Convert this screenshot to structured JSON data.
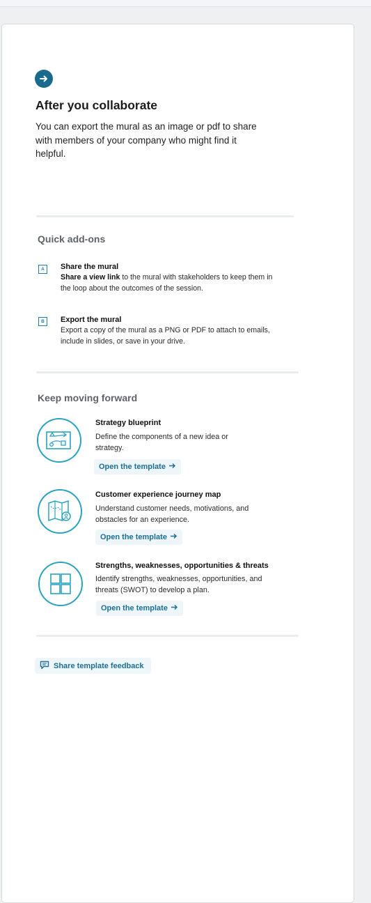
{
  "header": {
    "icon": "arrow-right-icon",
    "title": "After you collaborate",
    "intro": "You can export the mural as an image or pdf to share with members of your company who might find it helpful."
  },
  "quick_addons": {
    "heading": "Quick add-ons",
    "items": [
      {
        "badge": "A",
        "title": "Share the mural",
        "desc_bold": "Share a view link",
        "desc_rest": " to the mural with stakeholders to keep them in the loop about the outcomes of the session."
      },
      {
        "badge": "B",
        "title": "Export the mural",
        "desc_bold": "",
        "desc_rest": "Export a copy of the mural as a PNG or PDF to attach to emails, include in slides, or save in your drive."
      }
    ]
  },
  "forward": {
    "heading": "Keep moving forward",
    "templates": [
      {
        "icon": "strategy-blueprint-icon",
        "title": "Strategy blueprint",
        "desc": "Define the components of a new idea or strategy.",
        "button": "Open the template"
      },
      {
        "icon": "journey-map-icon",
        "title": "Customer experience journey map",
        "desc": "Understand customer needs, motivations, and obstacles for an experience.",
        "button": "Open the template"
      },
      {
        "icon": "swot-grid-icon",
        "title": "Strengths, weaknesses, opportunities & threats",
        "desc": "Identify strengths, weaknesses, opportunities, and threats (SWOT) to develop a plan.",
        "button": "Open the template"
      }
    ]
  },
  "feedback": {
    "icon": "comment-icon",
    "label": "Share template feedback"
  },
  "colors": {
    "accent": "#1a6a8c",
    "icon_ring": "#29a3bf",
    "button_bg": "#eef6fa",
    "button_text": "#1c6f95"
  }
}
